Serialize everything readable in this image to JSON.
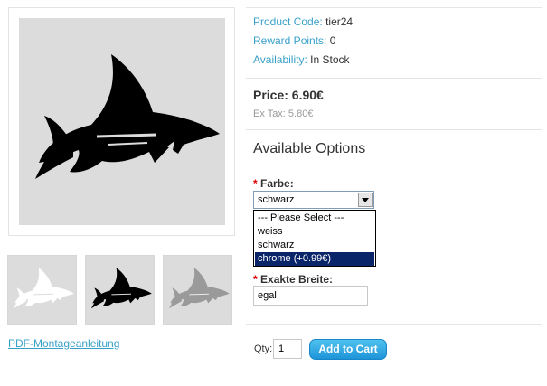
{
  "product_info": {
    "code_label": "Product Code:",
    "code_value": "tier24",
    "reward_label": "Reward Points:",
    "reward_value": "0",
    "availability_label": "Availability:",
    "availability_value": "In Stock"
  },
  "price": {
    "price_text": "Price: 6.90€",
    "ex_tax_text": "Ex Tax: 5.80€"
  },
  "options": {
    "title": "Available Options",
    "required_marker": "*",
    "farbe": {
      "label": "Farbe:",
      "selected": "schwarz",
      "items": [
        {
          "label": "--- Please Select ---",
          "highlighted": false
        },
        {
          "label": "weiss",
          "highlighted": false
        },
        {
          "label": "schwarz",
          "highlighted": false
        },
        {
          "label": "chrome (+0.99€)",
          "highlighted": true
        }
      ]
    },
    "breite": {
      "label": "Exakte Breite:",
      "value": "egal"
    }
  },
  "cart": {
    "qty_label": "Qty:",
    "qty_value": "1",
    "add_label": "Add to Cart"
  },
  "links": {
    "pdf": "PDF-Montageanleitung"
  },
  "images": {
    "main": "shark-decal-black",
    "thumbnails": [
      "shark-decal-white",
      "shark-decal-black",
      "shark-decal-chrome"
    ]
  },
  "colors": {
    "accent_link": "#38a0c8",
    "button": "#1e94d8",
    "dropdown_highlight": "#0a246a"
  }
}
